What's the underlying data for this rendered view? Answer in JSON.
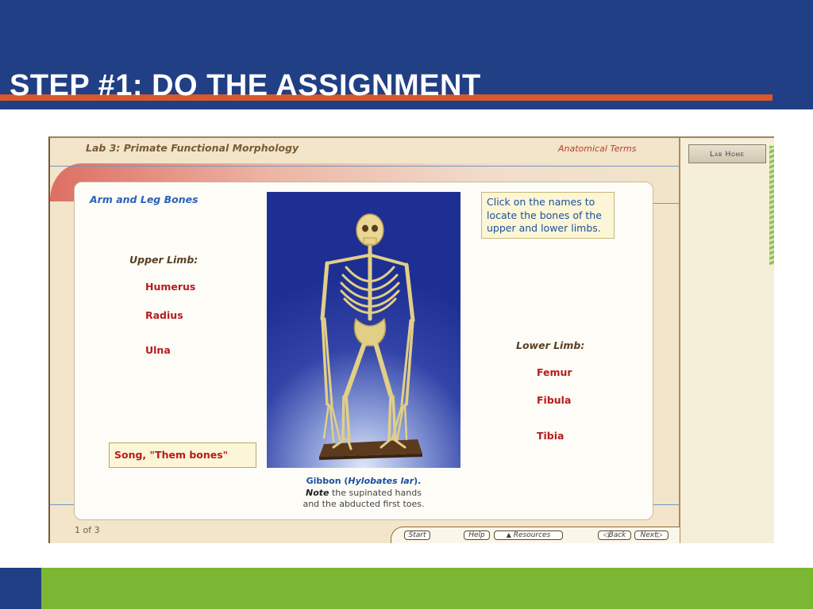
{
  "slide": {
    "title": "STEP #1:  DO THE ASSIGNMENT",
    "colors": {
      "header": "#213f84",
      "accent_bar": "#d9582c",
      "footer_green": "#7cb734"
    }
  },
  "app": {
    "lab_title": "Lab 3:  Primate Functional Morphology",
    "anatomical_terms": "Anatomical Terms",
    "lab_home": "Lab Home",
    "section_title": "Arm and Leg Bones",
    "instruction": "Click on the names to locate the bones of the upper and lower limbs.",
    "upper_limb": {
      "heading": "Upper Limb:",
      "bones": [
        "Humerus",
        "Radius",
        "Ulna"
      ]
    },
    "lower_limb": {
      "heading": "Lower Limb:",
      "bones": [
        "Femur",
        "Fibula",
        "Tibia"
      ]
    },
    "photo_icon": "gibbon-skeleton-image",
    "caption": {
      "name": "Gibbon (",
      "species": "Hylobates lar",
      "close": ").",
      "note": "Note",
      "text1": " the supinated hands",
      "text2": "and the abducted first toes."
    },
    "song_button": "Song, \"Them bones\"",
    "page_count": "1 of 3",
    "nav": {
      "start": "Start",
      "help": "Help",
      "resources": "Resources",
      "back": "Back",
      "next": "Next"
    }
  }
}
